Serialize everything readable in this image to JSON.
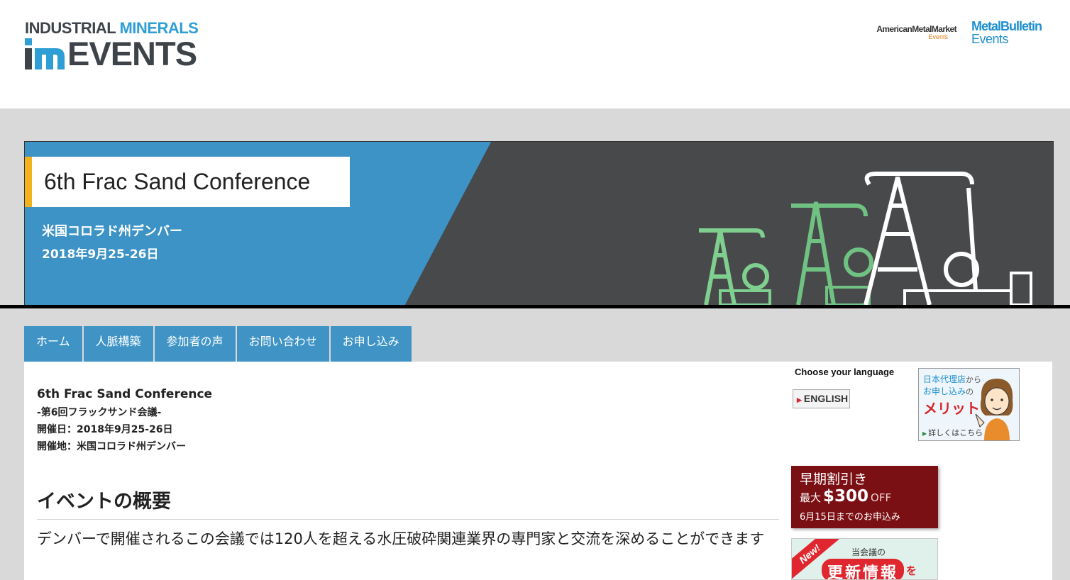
{
  "header": {
    "logo_line1_part1": "INDUSTRIAL",
    "logo_line1_part2": "MINERALS",
    "logo_line2": "EVENTS",
    "partner1_main": "AmericanMetalMarket",
    "partner1_sub": "Events",
    "partner2_main": "MetalBulletin",
    "partner2_sub": "Events"
  },
  "banner": {
    "title": "6th Frac Sand Conference",
    "location": "米国コロラド州デンバー",
    "date": "2018年9月25-26日"
  },
  "nav": {
    "items": [
      {
        "label": "ホーム"
      },
      {
        "label": "人脈構築"
      },
      {
        "label": "参加者の声"
      },
      {
        "label": "お問い合わせ"
      },
      {
        "label": "お申し込み"
      }
    ]
  },
  "main": {
    "event_title": "6th Frac Sand Conference",
    "event_subtitle": "-第6回フラックサンド会議-",
    "event_dates": "開催日：2018年9月25-26日",
    "event_venue": "開催地：米国コロラド州デンバー",
    "section_heading": "イベントの概要",
    "description": "デンバーで開催されるこの会議では120人を超える水圧破砕関連業界の専門家と交流を深めることができます"
  },
  "sidebar": {
    "language_label": "Choose your language",
    "language_button": "ENGLISH",
    "agent_banner": {
      "line1_a": "日本代理店",
      "line1_b": "から",
      "line2_a": "お申し込み",
      "line2_b": "の",
      "line3": "メリット",
      "link": "詳しくはこちら"
    },
    "early_bird": {
      "line1": "早期割引き",
      "prefix": "最大",
      "amount": "$300",
      "suffix": "OFF",
      "deadline": "6月15日までのお申込み"
    },
    "update_banner": {
      "ribbon": "New!",
      "line1": "当会議の",
      "line2": "更新情報",
      "suffix": "を"
    }
  },
  "colors": {
    "nav_blue": "#3f94c5",
    "banner_blue": "#3d93c6",
    "banner_dark": "#48494b",
    "accent_yellow": "#f2b21b",
    "early_bird_red": "#7b1014",
    "brand_blue": "#2f9ed4"
  },
  "icons": {
    "logo_mark": "im-logo-icon",
    "pumpjacks": "oil-pumpjack-illustration",
    "language_arrow": "triangle-right-icon",
    "agent_figure": "agent-woman-illustration"
  }
}
